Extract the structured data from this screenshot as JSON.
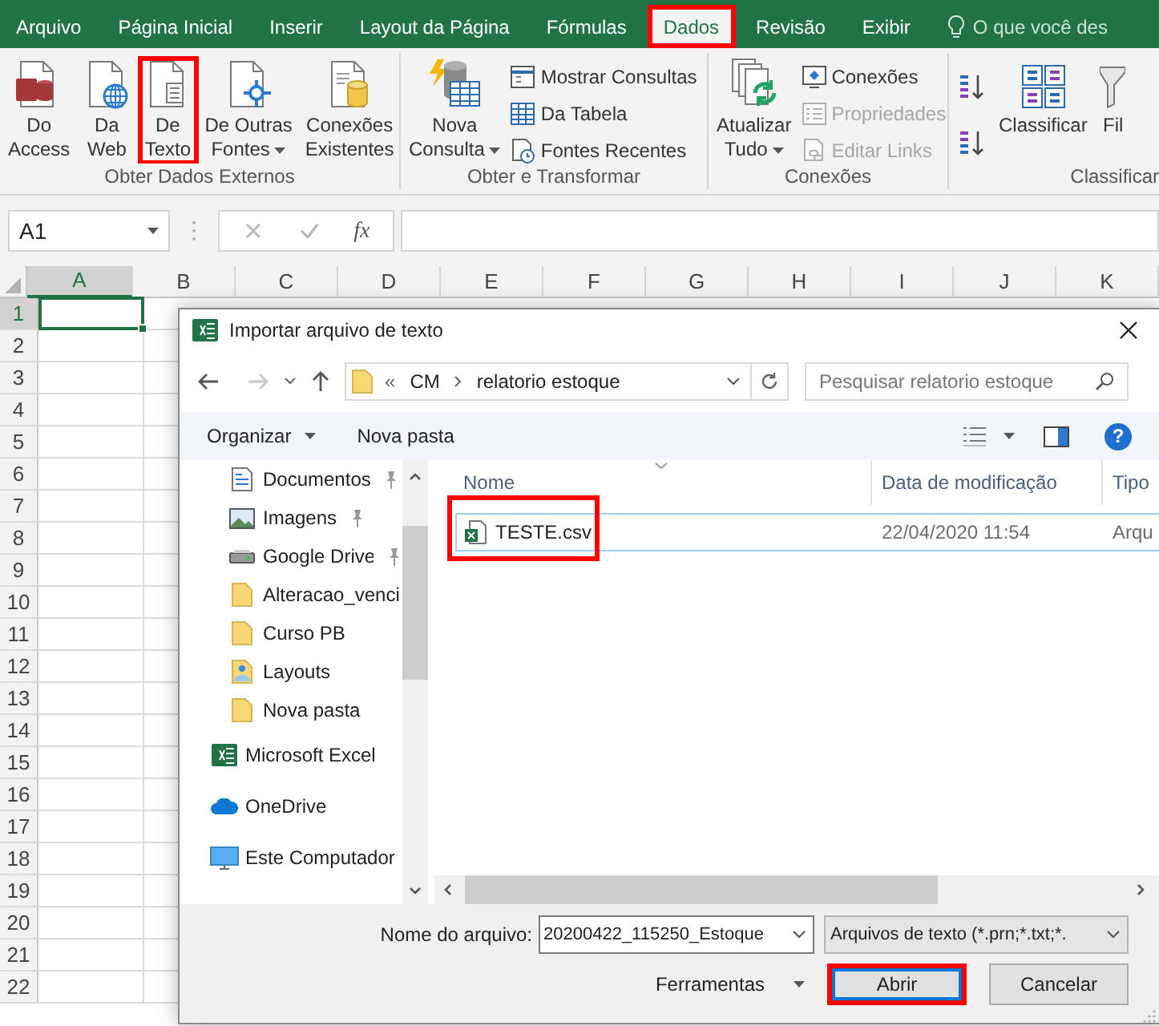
{
  "ribbon_tabs": [
    {
      "label": "Arquivo",
      "selected": false,
      "highlighted": false
    },
    {
      "label": "Página Inicial",
      "selected": false,
      "highlighted": false
    },
    {
      "label": "Inserir",
      "selected": false,
      "highlighted": false
    },
    {
      "label": "Layout da Página",
      "selected": false,
      "highlighted": false
    },
    {
      "label": "Fórmulas",
      "selected": false,
      "highlighted": false
    },
    {
      "label": "Dados",
      "selected": true,
      "highlighted": true
    },
    {
      "label": "Revisão",
      "selected": false,
      "highlighted": false
    },
    {
      "label": "Exibir",
      "selected": false,
      "highlighted": false
    }
  ],
  "tell_me": "O que você des",
  "ribbon_groups": [
    {
      "label": "Obter Dados Externos",
      "buttons": [
        {
          "kind": "large",
          "lines": [
            "Do",
            "Access"
          ],
          "dropdown": false,
          "highlighted": false
        },
        {
          "kind": "large",
          "lines": [
            "Da",
            "Web"
          ],
          "dropdown": false,
          "highlighted": false
        },
        {
          "kind": "large",
          "lines": [
            "De",
            "Texto"
          ],
          "dropdown": false,
          "highlighted": true
        },
        {
          "kind": "large",
          "lines": [
            "De Outras",
            "Fontes"
          ],
          "dropdown": true,
          "highlighted": false
        },
        {
          "kind": "large",
          "lines": [
            "Conexões",
            "Existentes"
          ],
          "dropdown": false,
          "highlighted": false
        }
      ]
    },
    {
      "label": "Obter e Transformar",
      "buttons": [
        {
          "kind": "large",
          "lines": [
            "Nova",
            "Consulta"
          ],
          "dropdown": true,
          "highlighted": false
        },
        {
          "kind": "small",
          "label": "Mostrar Consultas",
          "disabled": false
        },
        {
          "kind": "small",
          "label": "Da Tabela",
          "disabled": false
        },
        {
          "kind": "small",
          "label": "Fontes Recentes",
          "disabled": false
        }
      ]
    },
    {
      "label": "Conexões",
      "buttons": [
        {
          "kind": "large",
          "lines": [
            "Atualizar",
            "Tudo"
          ],
          "dropdown": true,
          "highlighted": false
        },
        {
          "kind": "small",
          "label": "Conexões",
          "disabled": false
        },
        {
          "kind": "small",
          "label": "Propriedades",
          "disabled": true
        },
        {
          "kind": "small",
          "label": "Editar Links",
          "disabled": true
        }
      ]
    },
    {
      "label": "Classificar",
      "buttons": [
        {
          "kind": "icon"
        },
        {
          "kind": "icon"
        },
        {
          "kind": "large",
          "lines": [
            "Classificar"
          ],
          "dropdown": false,
          "highlighted": false
        },
        {
          "kind": "large",
          "lines": [
            "Fil"
          ],
          "dropdown": false,
          "highlighted": false
        }
      ]
    }
  ],
  "name_box": "A1",
  "function_label": "fx",
  "columns": [
    {
      "label": "A",
      "selected": true
    },
    {
      "label": "B",
      "selected": false
    },
    {
      "label": "C",
      "selected": false
    },
    {
      "label": "D",
      "selected": false
    },
    {
      "label": "E",
      "selected": false
    },
    {
      "label": "F",
      "selected": false
    },
    {
      "label": "G",
      "selected": false
    },
    {
      "label": "H",
      "selected": false
    },
    {
      "label": "I",
      "selected": false
    },
    {
      "label": "J",
      "selected": false
    },
    {
      "label": "K",
      "selected": false
    }
  ],
  "rows": [
    {
      "label": "1",
      "selected": true
    },
    {
      "label": "2",
      "selected": false
    },
    {
      "label": "3",
      "selected": false
    },
    {
      "label": "4",
      "selected": false
    },
    {
      "label": "5",
      "selected": false
    },
    {
      "label": "6",
      "selected": false
    },
    {
      "label": "7",
      "selected": false
    },
    {
      "label": "8",
      "selected": false
    },
    {
      "label": "9",
      "selected": false
    },
    {
      "label": "10",
      "selected": false
    },
    {
      "label": "11",
      "selected": false
    },
    {
      "label": "12",
      "selected": false
    },
    {
      "label": "13",
      "selected": false
    },
    {
      "label": "14",
      "selected": false
    },
    {
      "label": "15",
      "selected": false
    },
    {
      "label": "16",
      "selected": false
    },
    {
      "label": "17",
      "selected": false
    },
    {
      "label": "18",
      "selected": false
    },
    {
      "label": "19",
      "selected": false
    },
    {
      "label": "20",
      "selected": false
    },
    {
      "label": "21",
      "selected": false
    },
    {
      "label": "22",
      "selected": false
    }
  ],
  "dialog": {
    "title": "Importar arquivo de texto",
    "path_overflow": "«",
    "path": [
      "CM",
      "relatorio estoque"
    ],
    "search": {
      "placeholder": "Pesquisar relatorio estoque"
    },
    "organize": "Organizar",
    "new_folder": "Nova pasta",
    "help": "?",
    "nav_items": [
      {
        "label": "Documentos",
        "kind": "documents",
        "pinned": true,
        "selected": false
      },
      {
        "label": "Imagens",
        "kind": "pictures",
        "pinned": true,
        "selected": false
      },
      {
        "label": "Google Drive",
        "kind": "drive",
        "pinned": true,
        "selected": false
      },
      {
        "label": "Alteracao_venci",
        "kind": "folder",
        "pinned": false,
        "selected": false
      },
      {
        "label": "Curso PB",
        "kind": "folder",
        "pinned": false,
        "selected": false
      },
      {
        "label": "Layouts",
        "kind": "shared-folder",
        "pinned": false,
        "selected": false
      },
      {
        "label": "Nova pasta",
        "kind": "folder",
        "pinned": false,
        "selected": false
      },
      {
        "label": "Microsoft Excel",
        "kind": "excel",
        "pinned": false,
        "selected": false
      },
      {
        "label": "OneDrive",
        "kind": "onedrive",
        "pinned": false,
        "selected": false
      },
      {
        "label": "Este Computador",
        "kind": "computer",
        "pinned": false,
        "selected": false
      }
    ],
    "file_columns": [
      "Nome",
      "Data de modificação",
      "Tipo"
    ],
    "files": [
      {
        "name": "TESTE.csv",
        "modified": "22/04/2020 11:54",
        "type": "Arqu",
        "selected": true,
        "highlighted": true
      }
    ],
    "file_name_label": "Nome do arquivo:",
    "file_name": "20200422_115250_Estoque",
    "file_type": "Arquivos de texto (*.prn;*.txt;*.",
    "tools": "Ferramentas",
    "buttons": [
      {
        "label": "Abrir",
        "kind": "primary",
        "highlighted": true
      },
      {
        "label": "Cancelar",
        "kind": "secondary",
        "highlighted": false
      }
    ]
  }
}
